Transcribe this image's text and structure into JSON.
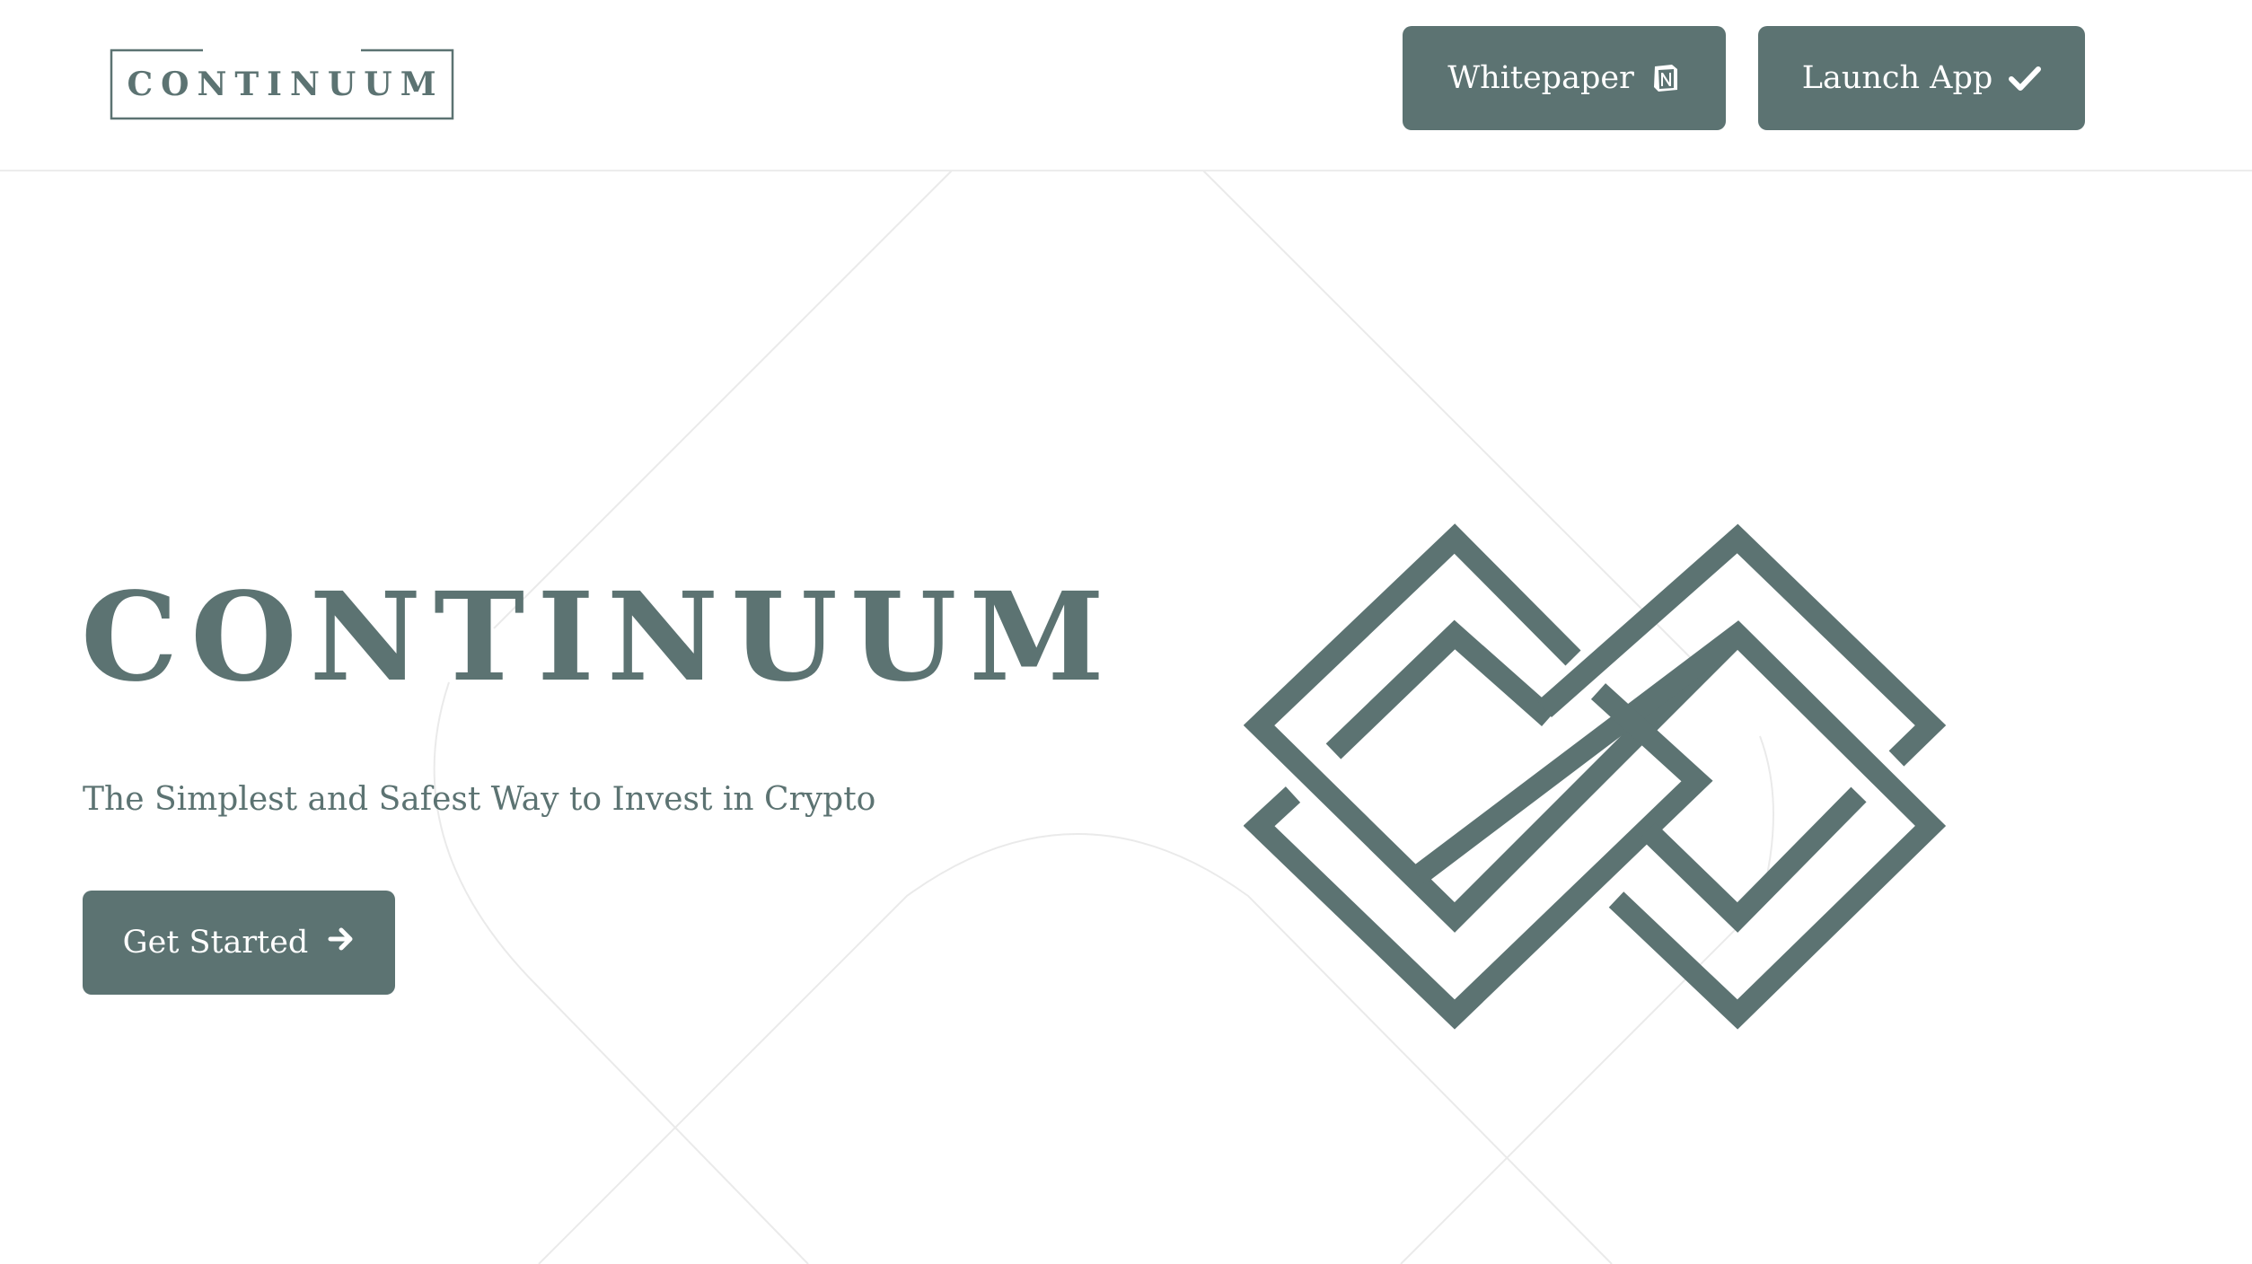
{
  "header": {
    "brand": "CONTINUUM",
    "buttons": {
      "whitepaper": "Whitepaper",
      "launch_app": "Launch App"
    }
  },
  "hero": {
    "title": "CONTINUUM",
    "subtitle": "The Simplest and Safest Way to Invest in Crypto",
    "cta": "Get Started"
  },
  "icons": {
    "whitepaper": "notion-icon",
    "launch_app": "check-icon",
    "cta": "arrow-right-icon",
    "hero_graphic": "continuum-logo-mark"
  },
  "colors": {
    "primary": "#5c7372",
    "background": "#ffffff",
    "button_text": "#ffffff",
    "divider": "#ececec"
  }
}
